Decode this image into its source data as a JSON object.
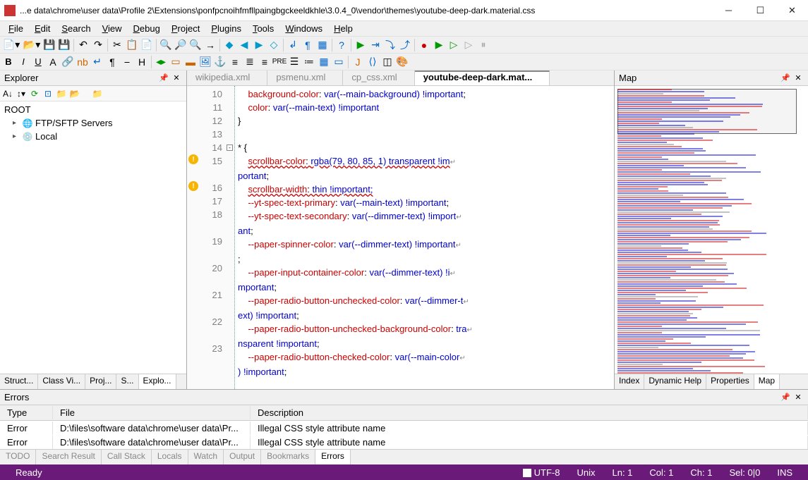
{
  "title": "...e data\\chrome\\user data\\Profile 2\\Extensions\\ponfpcnoihfmfllpaingbgckeeldkhle\\3.0.4_0\\vendor\\themes\\youtube-deep-dark.material.css",
  "menu": [
    "File",
    "Edit",
    "Search",
    "View",
    "Debug",
    "Project",
    "Plugins",
    "Tools",
    "Windows",
    "Help"
  ],
  "explorer": {
    "title": "Explorer",
    "root": "ROOT",
    "nodes": [
      {
        "label": "FTP/SFTP Servers",
        "icon": "globe"
      },
      {
        "label": "Local",
        "icon": "drive"
      }
    ]
  },
  "left_tabs": [
    "Struct...",
    "Class Vi...",
    "Proj...",
    "S...",
    "Explo..."
  ],
  "left_tab_active": 4,
  "editor_tabs": [
    "wikipedia.xml",
    "psmenu.xml",
    "cp_css.xml",
    "youtube-deep-dark.mat..."
  ],
  "editor_tab_active": 3,
  "code_lines": [
    {
      "n": 10,
      "html": "    <span class='kw'>background-color</span><span class='txt'>: </span><span class='val'>var(--main-background) !important</span><span class='txt'>;</span>"
    },
    {
      "n": 11,
      "html": "    <span class='kw'>color</span><span class='txt'>: </span><span class='val'>var(--main-text) !important</span>"
    },
    {
      "n": 12,
      "html": "<span class='txt'>}</span>"
    },
    {
      "n": 13,
      "html": ""
    },
    {
      "n": 14,
      "fold": "-",
      "html": "<span class='txt'>* {</span>"
    },
    {
      "n": 15,
      "warn": true,
      "html": "    <span class='kw err'>scrollbar-color</span><span class='txt err'>: </span><span class='val err'>rgba(79, 80, 85, 1) transparent !im</span><span class='wrap'>↵</span>",
      "cont": "<span class='val'>portant</span><span class='txt'>;</span>"
    },
    {
      "n": 16,
      "warn": true,
      "html": "    <span class='kw err'>scrollbar-width</span><span class='txt err'>: </span><span class='val err'>thin !important;</span>"
    },
    {
      "n": 17,
      "html": "    <span class='kw'>--yt-spec-text-primary</span><span class='txt'>: </span><span class='val'>var(--main-text) !important</span><span class='txt'>;</span>"
    },
    {
      "n": 18,
      "html": "    <span class='kw'>--yt-spec-text-secondary</span><span class='txt'>: </span><span class='val'>var(--dimmer-text) !import</span><span class='wrap'>↵</span>",
      "cont": "<span class='val'>ant</span><span class='txt'>;</span>"
    },
    {
      "n": 19,
      "html": "    <span class='kw'>--paper-spinner-color</span><span class='txt'>: </span><span class='val'>var(--dimmer-text) !important</span><span class='wrap'>↵</span>",
      "cont": "<span class='txt'>;</span>"
    },
    {
      "n": 20,
      "html": "    <span class='kw'>--paper-input-container-color</span><span class='txt'>: </span><span class='val'>var(--dimmer-text) !i</span><span class='wrap'>↵</span>",
      "cont": "<span class='val'>mportant</span><span class='txt'>;</span>"
    },
    {
      "n": 21,
      "html": "    <span class='kw'>--paper-radio-button-unchecked-color</span><span class='txt'>: </span><span class='val'>var(--dimmer-t</span><span class='wrap'>↵</span>",
      "cont": "<span class='val'>ext) !important</span><span class='txt'>;</span>"
    },
    {
      "n": 22,
      "html": "    <span class='kw'>--paper-radio-button-unchecked-background-color</span><span class='txt'>: </span><span class='val'>tra</span><span class='wrap'>↵</span>",
      "cont": "<span class='val'>nsparent !important</span><span class='txt'>;</span>"
    },
    {
      "n": 23,
      "html": "    <span class='kw'>--paper-radio-button-checked-color</span><span class='txt'>: </span><span class='val'>var(--main-color</span><span class='wrap'>↵</span>",
      "cont": "<span class='val'>) !important</span><span class='txt'>;</span>"
    }
  ],
  "map": {
    "title": "Map"
  },
  "right_tabs": [
    "Index",
    "Dynamic Help",
    "Properties",
    "Map"
  ],
  "right_tab_active": 3,
  "errors_panel": {
    "title": "Errors",
    "cols": [
      "Type",
      "File",
      "Description"
    ],
    "rows": [
      {
        "type": "Error",
        "file": "D:\\files\\software data\\chrome\\user data\\Pr...",
        "desc": "Illegal CSS style attribute name"
      },
      {
        "type": "Error",
        "file": "D:\\files\\software data\\chrome\\user data\\Pr...",
        "desc": "Illegal CSS style attribute name"
      }
    ]
  },
  "bottom_tabs": [
    "TODO",
    "Search Result",
    "Call Stack",
    "Locals",
    "Watch",
    "Output",
    "Bookmarks",
    "Errors"
  ],
  "bottom_tab_active": 7,
  "status": {
    "ready": "Ready",
    "encoding": "UTF-8",
    "eol": "Unix",
    "ln": "Ln: 1",
    "col": "Col: 1",
    "ch": "Ch: 1",
    "sel": "Sel: 0|0",
    "ins": "INS"
  }
}
